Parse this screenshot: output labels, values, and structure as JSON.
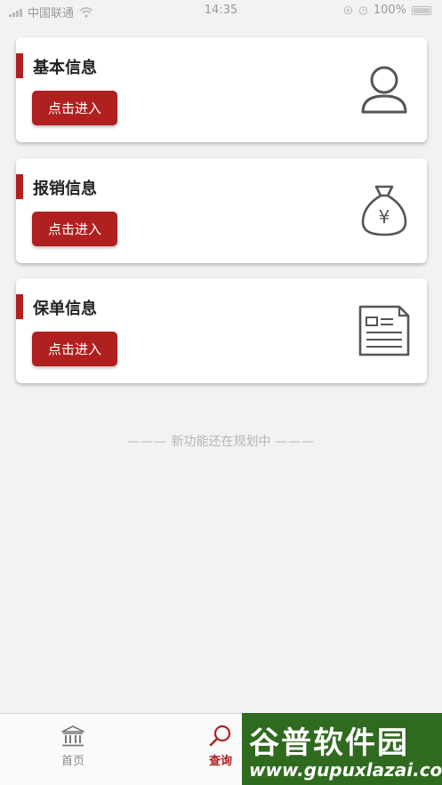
{
  "status_bar": {
    "carrier": "中国联通",
    "time": "14:35",
    "battery": "100%"
  },
  "cards": [
    {
      "title": "基本信息",
      "button": "点击进入",
      "icon": "person-icon"
    },
    {
      "title": "报销信息",
      "button": "点击进入",
      "icon": "money-bag-icon",
      "symbol": "¥"
    },
    {
      "title": "保单信息",
      "button": "点击进入",
      "icon": "document-icon"
    }
  ],
  "notice": {
    "dash_left": "———",
    "text": "新功能还在规划中",
    "dash_right": "———"
  },
  "tabbar": {
    "home_label": "首页",
    "query_label": "查询"
  },
  "watermark": {
    "title": "谷普软件园",
    "url": "www.gupuxlazai.com"
  },
  "colors": {
    "accent": "#b0201f",
    "background": "#f2f2f2",
    "watermark": "#2f6a1f"
  }
}
